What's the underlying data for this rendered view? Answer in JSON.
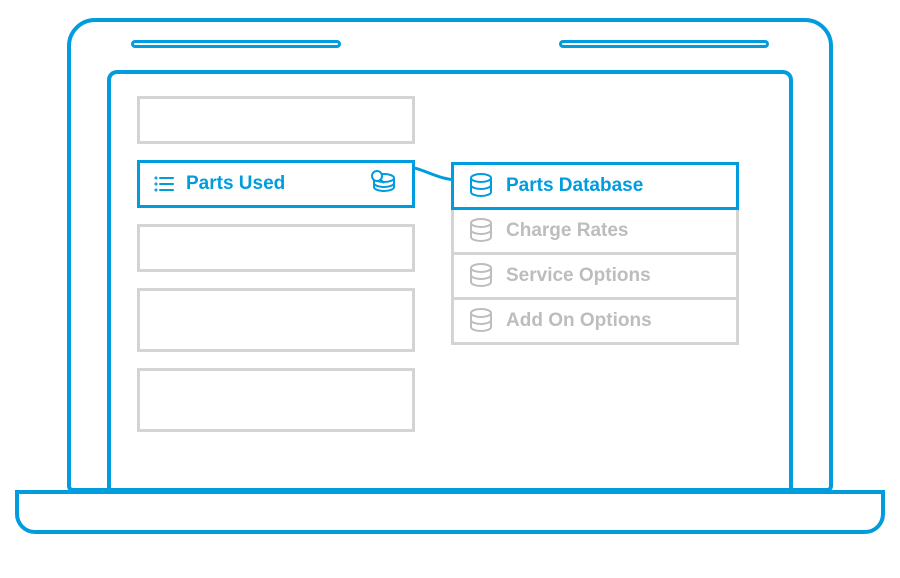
{
  "colors": {
    "accent": "#009cde",
    "muted": "#bdbdbd",
    "mutedBorder": "#d4d4d4"
  },
  "left": {
    "active_label": "Parts Used"
  },
  "right": {
    "items": [
      {
        "label": "Parts Database",
        "active": true
      },
      {
        "label": "Charge Rates",
        "active": false
      },
      {
        "label": "Service Options",
        "active": false
      },
      {
        "label": "Add On Options",
        "active": false
      }
    ]
  }
}
